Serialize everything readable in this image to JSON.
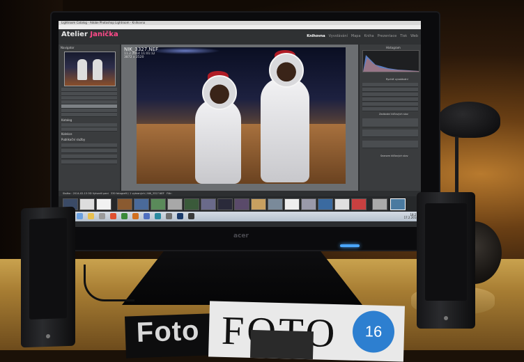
{
  "scene": {
    "monitor_brand": "acer",
    "magazine_1_title": "Foto",
    "magazine_2_title": "FOTO",
    "magazine_2_number": "16"
  },
  "app": {
    "window_title": "Lightroom Catalog - Adobe Photoshop Lightroom - Knihovna",
    "identity_plate": {
      "text": "Atelier ",
      "accent": "Janička",
      "accent_color": "#ff4a8a"
    },
    "modules": [
      "Knihovna",
      "Vyvolávání",
      "Mapa",
      "Kniha",
      "Prezentace",
      "Tisk",
      "Web"
    ],
    "active_module": "Knihovna",
    "navigator_label": "Navigator",
    "histogram_label": "Histogram",
    "image_info": {
      "filename": "NIK_3327.NEF",
      "date": "11.2.2014 11:01:12",
      "dimensions": "3872 x 2520"
    },
    "left_panel": {
      "sections": [
        "Katalog",
        "Kolekce",
        "Publikační služby"
      ]
    },
    "right_panel": {
      "sections": [
        "Rychlé vyvolávání",
        "Zadávání klíčových slov",
        "Seznam klíčových slov"
      ]
    },
    "filmstrip": {
      "path_text": "Složka : 2014-02-13 OD Vytvorili pani",
      "count_text": "330 fotografií / 1 vybraných / NIK_3327.NEF",
      "filter_label": "Filtr:"
    },
    "clock": {
      "time": "18:27",
      "date": "17.2.2014"
    }
  }
}
